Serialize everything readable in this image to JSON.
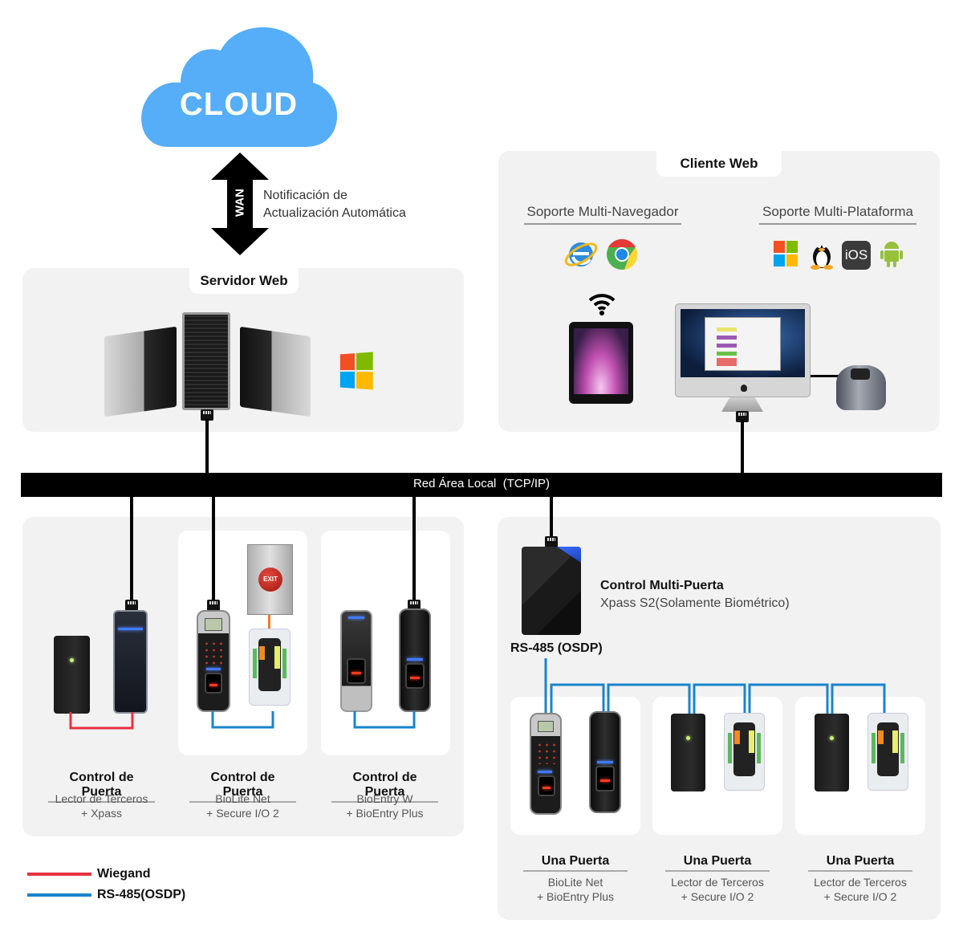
{
  "cloud": {
    "label": "CLOUD",
    "color": "#55aef7"
  },
  "wan": {
    "label": "WAN",
    "notification_line1": "Notificación de",
    "notification_line2": "Actualización Automática"
  },
  "server_panel": {
    "title": "Servidor Web",
    "os_icon": "windows-icon"
  },
  "client_panel": {
    "title": "Cliente Web",
    "browser_heading": "Soporte Multi-Navegador",
    "platform_heading": "Soporte Multi-Plataforma",
    "browsers": [
      "internet-explorer-icon",
      "chrome-icon"
    ],
    "platforms": [
      "windows-icon",
      "linux-icon",
      "ios-icon",
      "android-icon"
    ],
    "ios_label": "iOS",
    "devices": [
      "wifi-icon",
      "tablet",
      "desktop-computer",
      "fingerprint-scanner"
    ]
  },
  "lan": {
    "label": "Red Área Local  (TCP/IP)"
  },
  "door_controls": [
    {
      "title": "Control de Puerta",
      "line1": "Lector de Terceros",
      "line2": "+ Xpass",
      "link": "Wiegand"
    },
    {
      "title": "Control de Puerta",
      "line1": "BioLite Net",
      "line2": "+ Secure I/O 2",
      "link": "RS-485(OSDP)",
      "exit_label": "EXIT"
    },
    {
      "title": "Control de Puerta",
      "line1": "BioEntry W",
      "line2": "+ BioEntry Plus",
      "link": "RS-485(OSDP)"
    }
  ],
  "multi_door": {
    "title": "Control Multi-Puerta",
    "subtitle": "Xpass S2(Solamente Biométrico)",
    "bus_label": "RS-485 (OSDP)",
    "doors": [
      {
        "title": "Una Puerta",
        "line1": "BioLite Net",
        "line2": "+ BioEntry Plus"
      },
      {
        "title": "Una Puerta",
        "line1": "Lector de Terceros",
        "line2": "+ Secure I/O 2"
      },
      {
        "title": "Una Puerta",
        "line1": "Lector de Terceros",
        "line2": "+ Secure I/O 2"
      }
    ]
  },
  "legend": [
    {
      "label": "Wiegand",
      "color": "#e8313f"
    },
    {
      "label": "RS-485(OSDP)",
      "color": "#1a84cc"
    }
  ],
  "colors": {
    "wiegand": "#e8313f",
    "rs485": "#1a84cc",
    "exit_wire": "#f07a2a",
    "panel_bg": "#f2f2f2",
    "lan_bar": "#000000"
  }
}
